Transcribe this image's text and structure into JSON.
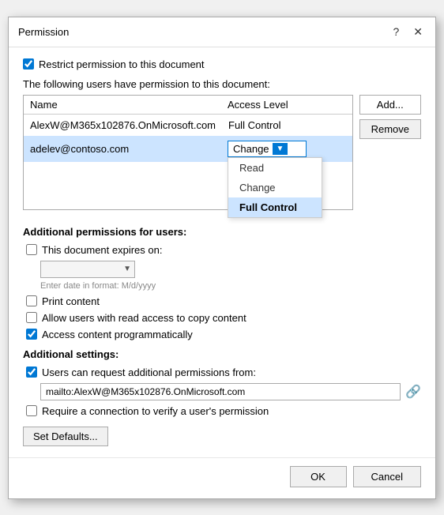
{
  "dialog": {
    "title": "Permission",
    "help_icon": "?",
    "close_icon": "✕"
  },
  "restrict_checkbox": {
    "label": "Restrict permission to this document",
    "checked": true
  },
  "users_section": {
    "label": "The following users have permission to this document:",
    "columns": {
      "name": "Name",
      "access": "Access Level"
    },
    "rows": [
      {
        "name": "AlexW@M365x102876.OnMicrosoft.com",
        "access": "Full Control",
        "selected": false
      },
      {
        "name": "adelev@contoso.com",
        "access": "Change",
        "selected": true
      }
    ],
    "add_button": "Add...",
    "remove_button": "Remove",
    "dropdown": {
      "options": [
        "Read",
        "Change",
        "Full Control"
      ],
      "selected": "Full Control"
    }
  },
  "additional_permissions": {
    "title": "Additional permissions for users:",
    "expires_label": "This document expires on:",
    "expires_checked": false,
    "date_placeholder": "",
    "date_hint": "Enter date in format: M/d/yyyy",
    "print_label": "Print content",
    "print_checked": false,
    "copy_label": "Allow users with read access to copy content",
    "copy_checked": false,
    "programmatic_label": "Access content programmatically",
    "programmatic_checked": true
  },
  "additional_settings": {
    "title": "Additional settings:",
    "request_label": "Users can request additional permissions from:",
    "request_checked": true,
    "email_value": "mailto:AlexW@M365x102876.OnMicrosoft.com",
    "require_connection_label": "Require a connection to verify a user's permission",
    "require_connection_checked": false,
    "defaults_button": "Set Defaults..."
  },
  "footer": {
    "ok_label": "OK",
    "cancel_label": "Cancel"
  }
}
